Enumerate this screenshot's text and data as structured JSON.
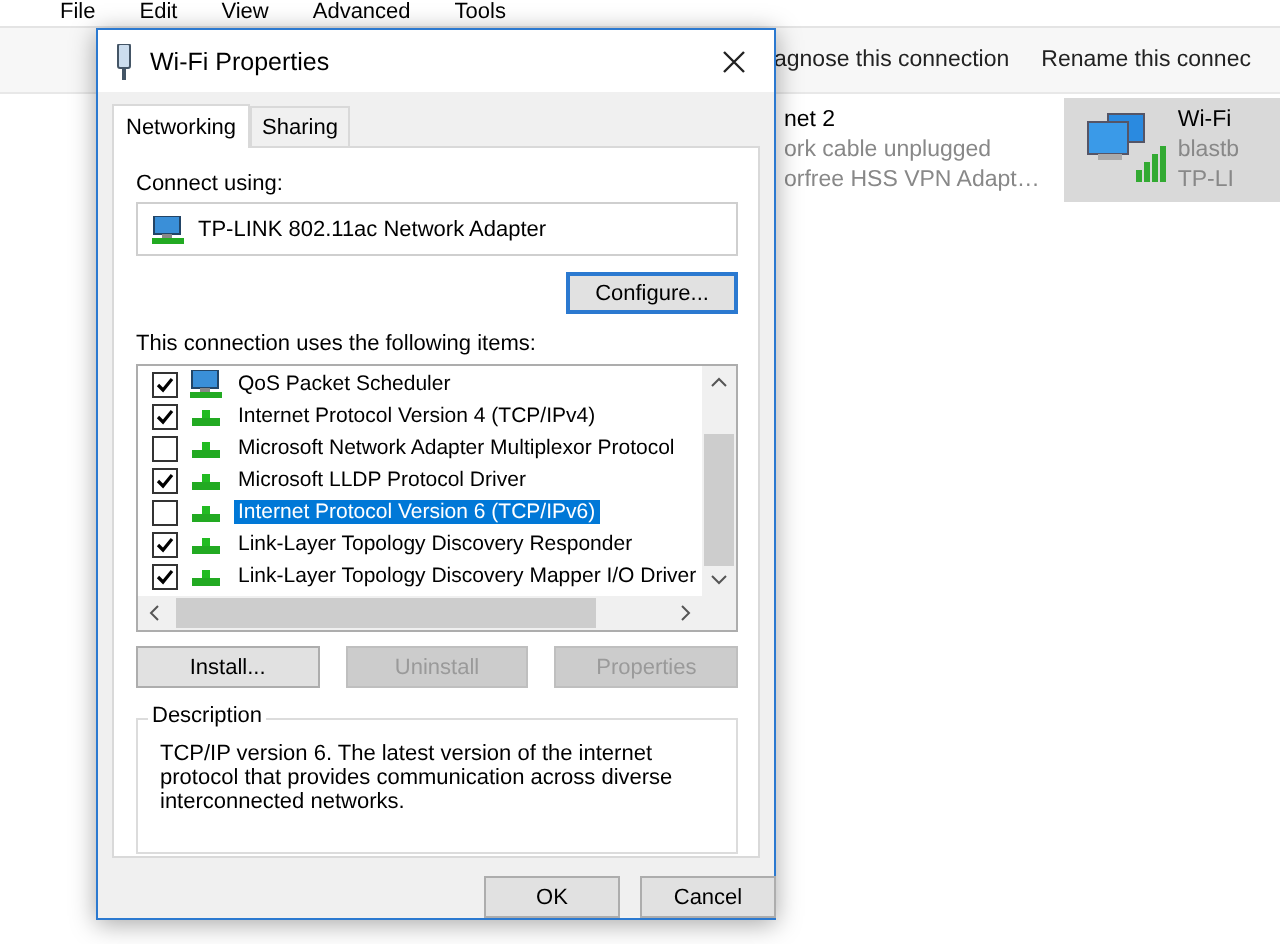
{
  "background_window": {
    "menu": [
      "File",
      "Edit",
      "View",
      "Advanced",
      "Tools"
    ],
    "toolbar": [
      "agnose this connection",
      "Rename this connec"
    ],
    "connections": [
      {
        "lines": [
          "net 2",
          "ork cable unplugged",
          "orfree HSS VPN Adapt…"
        ],
        "selected": false,
        "kind": "wired"
      },
      {
        "lines": [
          "Wi-Fi",
          "blastb",
          "TP-LI"
        ],
        "selected": true,
        "kind": "wireless"
      }
    ]
  },
  "dialog": {
    "title": "Wi-Fi Properties",
    "tabs": [
      {
        "label": "Networking",
        "selected": true
      },
      {
        "label": "Sharing",
        "selected": false
      }
    ],
    "connect_using_label": "Connect using:",
    "adapter": "TP-LINK 802.11ac Network Adapter",
    "configure_button": {
      "label": "Configure...",
      "focused": true
    },
    "items_label": "This connection uses the following items:",
    "items": [
      {
        "label": "QoS Packet Scheduler",
        "checked": true,
        "selected": false,
        "kind": "service"
      },
      {
        "label": "Internet Protocol Version 4 (TCP/IPv4)",
        "checked": true,
        "selected": false,
        "kind": "protocol"
      },
      {
        "label": "Microsoft Network Adapter Multiplexor Protocol",
        "checked": false,
        "selected": false,
        "kind": "protocol"
      },
      {
        "label": "Microsoft LLDP Protocol Driver",
        "checked": true,
        "selected": false,
        "kind": "protocol"
      },
      {
        "label": "Internet Protocol Version 6 (TCP/IPv6)",
        "checked": false,
        "selected": true,
        "kind": "protocol"
      },
      {
        "label": "Link-Layer Topology Discovery Responder",
        "checked": true,
        "selected": false,
        "kind": "protocol"
      },
      {
        "label": "Link-Layer Topology Discovery Mapper I/O Driver",
        "checked": true,
        "selected": false,
        "kind": "protocol"
      }
    ],
    "item_buttons": [
      {
        "label": "Install...",
        "disabled": false
      },
      {
        "label": "Uninstall",
        "disabled": true
      },
      {
        "label": "Properties",
        "disabled": true
      }
    ],
    "description": {
      "title": "Description",
      "text": "TCP/IP version 6. The latest version of the internet protocol that provides communication across diverse interconnected networks."
    },
    "footer_buttons": [
      "OK",
      "Cancel"
    ]
  }
}
